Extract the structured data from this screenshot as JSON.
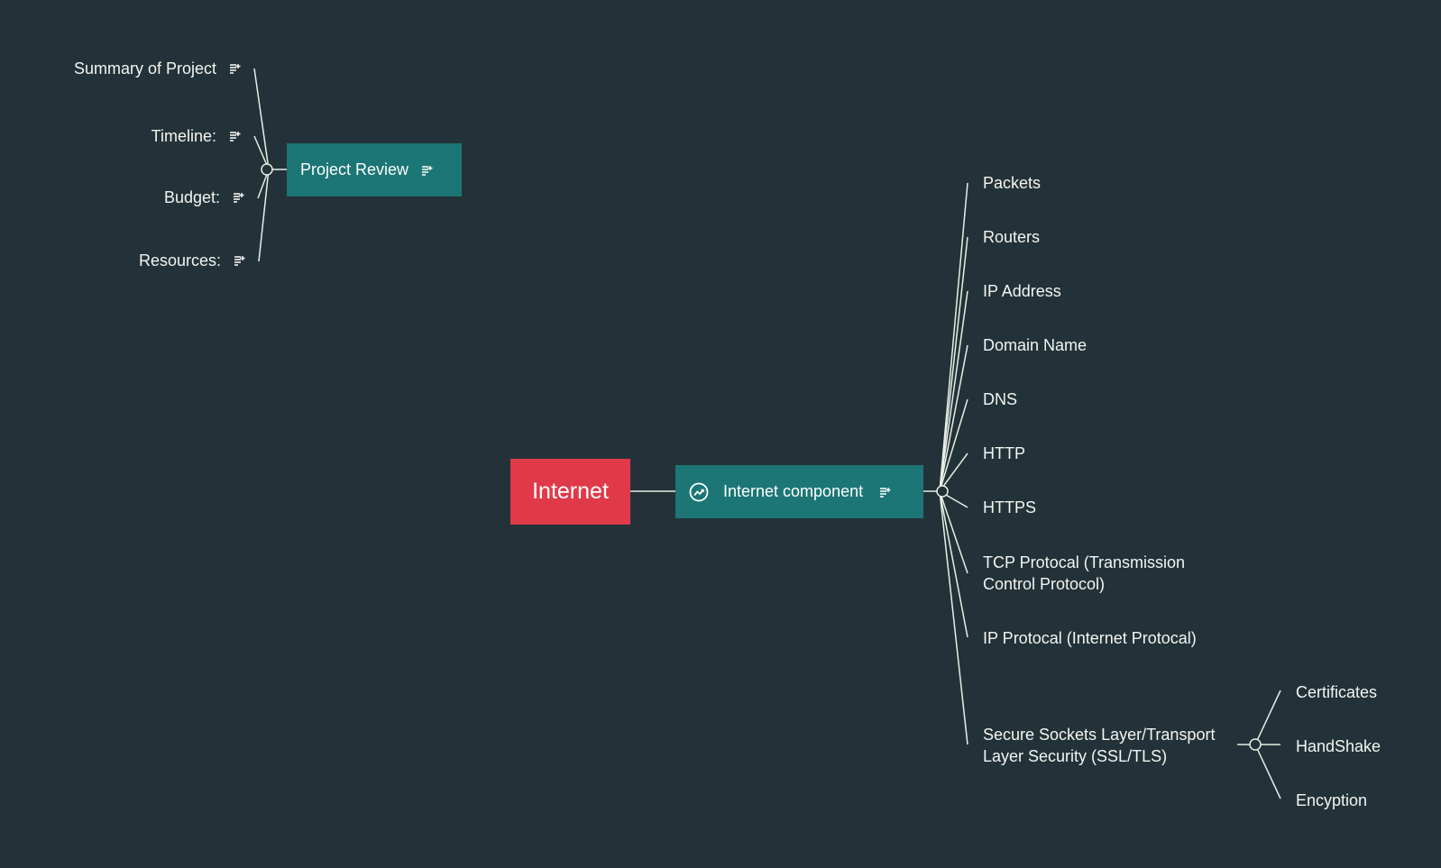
{
  "mindmap": {
    "root": {
      "label": "Internet"
    },
    "branches": [
      {
        "label": "Project Review",
        "icon": "note-icon",
        "children": [
          {
            "label": "Summary of Project",
            "icon": "note-icon"
          },
          {
            "label": "Timeline:",
            "icon": "note-icon"
          },
          {
            "label": "Budget:",
            "icon": "note-icon"
          },
          {
            "label": "Resources:",
            "icon": "note-icon"
          }
        ]
      },
      {
        "label": "Internet component",
        "leading_icon": "trend-circle-icon",
        "icon": "note-icon",
        "children": [
          {
            "label": "Packets"
          },
          {
            "label": "Routers"
          },
          {
            "label": "IP Address"
          },
          {
            "label": "Domain Name"
          },
          {
            "label": "DNS"
          },
          {
            "label": "HTTP"
          },
          {
            "label": "HTTPS"
          },
          {
            "label": "TCP Protocal (Transmission Control Protocol)"
          },
          {
            "label": "IP  Protocal (Internet Protocal)"
          },
          {
            "label": "Secure Sockets Layer/Transport Layer Security (SSL/TLS)",
            "children": [
              {
                "label": "Certificates"
              },
              {
                "label": "HandShake"
              },
              {
                "label": "Encyption"
              }
            ]
          }
        ]
      }
    ]
  },
  "colors": {
    "background": "#233238",
    "root_fill": "#e03a4a",
    "branch_fill": "#1b7675",
    "connector": "#e6efe6",
    "text": "#f2f5f2"
  }
}
